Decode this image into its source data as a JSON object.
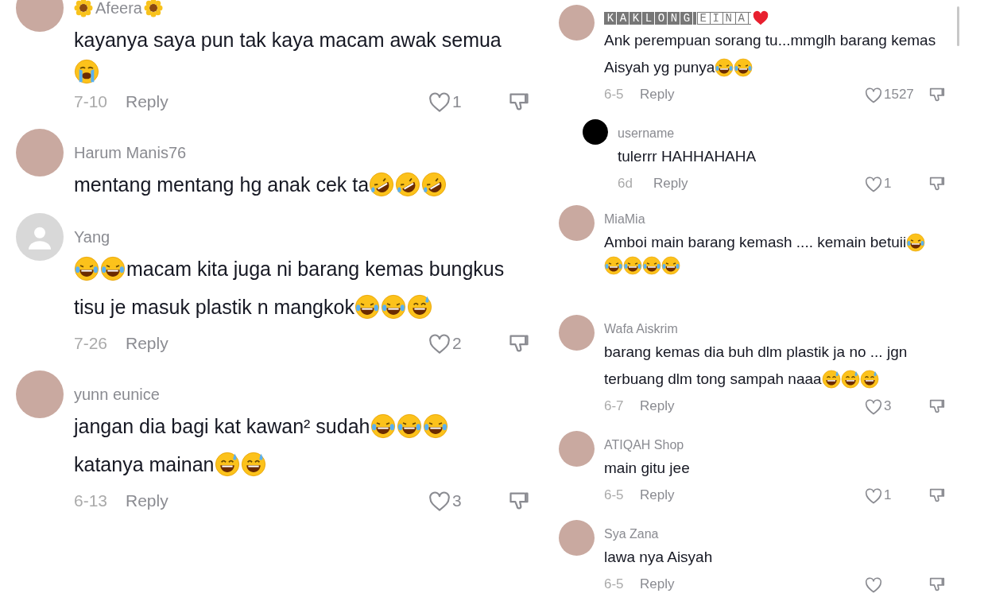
{
  "panels": [
    {
      "comments": [
        {
          "kind": "comment",
          "avatar": {
            "kind": "photo"
          },
          "username": [
            {
              "kind": "flower"
            },
            {
              "kind": "plain",
              "text": "Afeera"
            },
            {
              "kind": "flower"
            }
          ],
          "lines": [
            [
              {
                "kind": "text",
                "text": "kayanya saya pun tak kaya macam awak semua"
              }
            ],
            [
              {
                "kind": "emoji_cry"
              }
            ]
          ],
          "actions": {
            "date": "7-10",
            "reply": "Reply",
            "likes": "1"
          }
        },
        {
          "kind": "comment",
          "avatar": {
            "kind": "photo"
          },
          "username": [
            {
              "kind": "plain",
              "text": "Harum Manis76"
            }
          ],
          "lines": [
            [
              {
                "kind": "text",
                "text": "mentang mentang hg anak cek ta"
              },
              {
                "kind": "emoji_rofl"
              },
              {
                "kind": "emoji_rofl"
              },
              {
                "kind": "emoji_rofl"
              }
            ]
          ]
        },
        {
          "kind": "comment",
          "avatar": {
            "kind": "default"
          },
          "username": [
            {
              "kind": "plain",
              "text": "Yang"
            }
          ],
          "lines": [
            [
              {
                "kind": "emoji_laugh"
              },
              {
                "kind": "emoji_laugh"
              },
              {
                "kind": "text",
                "text": "macam kita juga ni barang kemas bungkus"
              }
            ],
            [
              {
                "kind": "text",
                "text": "tisu je masuk plastik n mangkok"
              },
              {
                "kind": "emoji_laugh"
              },
              {
                "kind": "emoji_laugh"
              },
              {
                "kind": "emoji_sweat"
              }
            ]
          ],
          "actions": {
            "date": "7-26",
            "reply": "Reply",
            "likes": "2"
          }
        },
        {
          "kind": "comment",
          "avatar": {
            "kind": "photo"
          },
          "username": [
            {
              "kind": "plain",
              "text": "yunn eunice"
            }
          ],
          "lines": [
            [
              {
                "kind": "text",
                "text": "jangan dia bagi kat kawan² sudah"
              },
              {
                "kind": "emoji_laugh"
              },
              {
                "kind": "emoji_laugh"
              },
              {
                "kind": "emoji_laugh"
              }
            ],
            [
              {
                "kind": "text",
                "text": "katanya mainan"
              },
              {
                "kind": "emoji_sweat"
              },
              {
                "kind": "emoji_sweat"
              }
            ]
          ],
          "actions": {
            "date": "6-13",
            "reply": "Reply",
            "likes": "3"
          }
        }
      ]
    },
    {
      "comments": [
        {
          "kind": "comment",
          "avatar": {
            "kind": "photo"
          },
          "username": [
            {
              "kind": "filled",
              "text": "KAKLONG"
            },
            {
              "kind": "outlined",
              "text": "EINA"
            },
            {
              "kind": "heart"
            }
          ],
          "lines": [
            [
              {
                "kind": "text",
                "text": "Ank perempuan sorang tu...mmglh barang kemas"
              }
            ],
            [
              {
                "kind": "text",
                "text": "Aisyah yg punya"
              },
              {
                "kind": "emoji_laugh"
              },
              {
                "kind": "emoji_laugh"
              }
            ]
          ],
          "actions": {
            "date": "6-5",
            "reply": "Reply",
            "likes": "1527"
          }
        },
        {
          "kind": "reply",
          "avatar": {
            "kind": "blank"
          },
          "username": [
            {
              "kind": "plain",
              "text": "username"
            }
          ],
          "lines": [
            [
              {
                "kind": "text",
                "text": "tulerrr HAHHAHAHA"
              }
            ]
          ],
          "actions": {
            "date": "6d",
            "reply": "Reply",
            "likes": "1"
          }
        },
        {
          "kind": "comment",
          "avatar": {
            "kind": "photo"
          },
          "username": [
            {
              "kind": "plain",
              "text": "MiaMia"
            }
          ],
          "lines": [
            [
              {
                "kind": "text",
                "text": "Amboi main barang kemash .... kemain betuii"
              },
              {
                "kind": "emoji_laugh"
              }
            ],
            [
              {
                "kind": "emoji_laugh"
              },
              {
                "kind": "emoji_laugh"
              },
              {
                "kind": "emoji_laugh"
              },
              {
                "kind": "emoji_laugh"
              }
            ]
          ]
        },
        {
          "kind": "comment",
          "avatar": {
            "kind": "photo"
          },
          "username": [
            {
              "kind": "plain",
              "text": "Wafa Aiskrim"
            }
          ],
          "lines": [
            [
              {
                "kind": "text",
                "text": "barang kemas dia buh dlm plastik ja no ... jgn"
              }
            ],
            [
              {
                "kind": "text",
                "text": "terbuang dlm tong sampah naaa"
              },
              {
                "kind": "emoji_sweat"
              },
              {
                "kind": "emoji_sweat"
              },
              {
                "kind": "emoji_sweat"
              }
            ]
          ],
          "actions": {
            "date": "6-7",
            "reply": "Reply",
            "likes": "3"
          }
        },
        {
          "kind": "comment",
          "avatar": {
            "kind": "photo"
          },
          "username": [
            {
              "kind": "plain",
              "text": "ATIQAH Shop"
            }
          ],
          "lines": [
            [
              {
                "kind": "text",
                "text": "main gitu jee"
              }
            ]
          ],
          "actions": {
            "date": "6-5",
            "reply": "Reply",
            "likes": "1"
          }
        },
        {
          "kind": "comment",
          "avatar": {
            "kind": "photo"
          },
          "username": [
            {
              "kind": "plain",
              "text": "Sya Zana"
            }
          ],
          "lines": [
            [
              {
                "kind": "text",
                "text": "lawa nya Aisyah"
              }
            ]
          ],
          "actions": {
            "date": "6-5",
            "reply": "Reply"
          }
        }
      ]
    }
  ]
}
